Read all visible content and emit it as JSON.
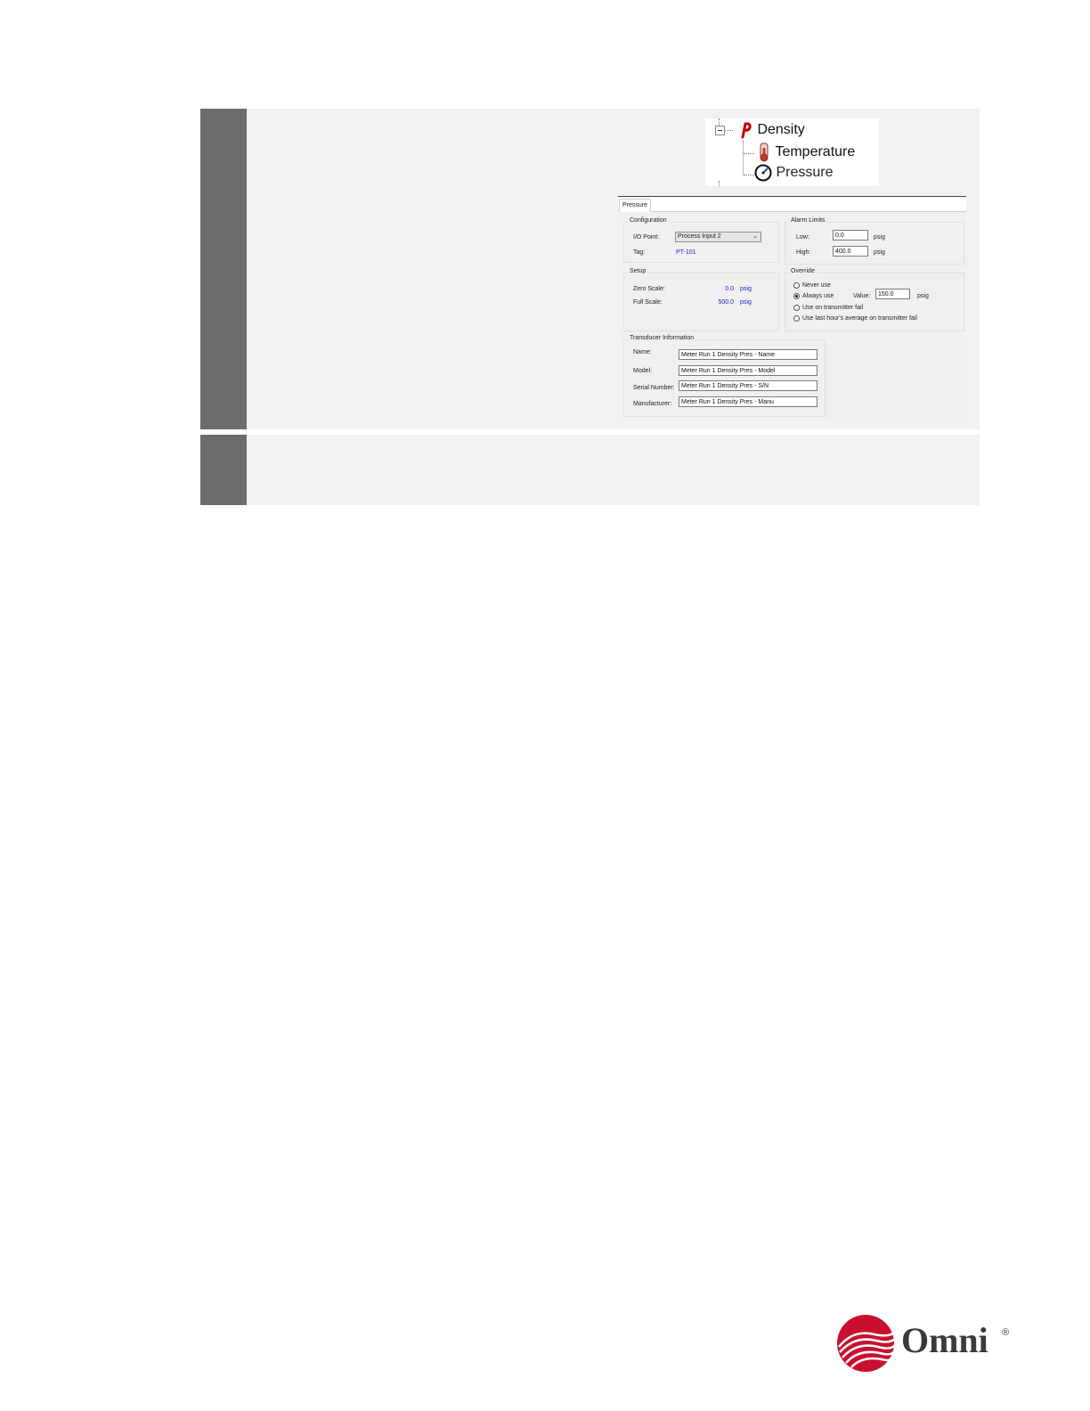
{
  "tree": {
    "items": [
      {
        "label": "Density",
        "icon": "density-icon"
      },
      {
        "label": "Temperature",
        "icon": "thermometer-icon"
      },
      {
        "label": "Pressure",
        "icon": "pressure-gauge-icon",
        "selected": true
      }
    ]
  },
  "dialog": {
    "tab": "Pressure",
    "configuration": {
      "title": "Configuration",
      "io_point_label": "I/O Point:",
      "io_point_value": "Process Input 2",
      "tag_label": "Tag:",
      "tag_value": "PT-101"
    },
    "alarm_limits": {
      "title": "Alarm Limits",
      "low_label": "Low:",
      "low_value": "0.0",
      "high_label": "High:",
      "high_value": "400.0",
      "unit": "psig"
    },
    "setup": {
      "title": "Setup",
      "zero_label": "Zero Scale:",
      "zero_value": "0.0",
      "full_label": "Full Scale:",
      "full_value": "500.0",
      "unit": "psig"
    },
    "override": {
      "title": "Override",
      "options": [
        "Never use",
        "Always use",
        "Use on transmitter fail",
        "Use last hour's average on transmitter fail"
      ],
      "selected_index": 1,
      "value_label": "Value:",
      "value": "150.0",
      "unit": "psig"
    },
    "transducer": {
      "title": "Transducer Information",
      "name_label": "Name:",
      "name_value": "Meter Run 1 Density Pres - Name",
      "model_label": "Model:",
      "model_value": "Meter Run 1 Density Pres - Model",
      "serial_label": "Serial Number:",
      "serial_value": "Meter Run 1 Density Pres - S/N",
      "manufacturer_label": "Manufacturer:",
      "manufacturer_value": "Meter Run 1 Density Pres - Manu"
    }
  },
  "logo": {
    "text": "Omni",
    "registered": "®",
    "color": "#c8102e"
  },
  "colors": {
    "step_bar": "#6d6b6c",
    "step_bg": "#f1f1f1",
    "selection": "#3399ff"
  }
}
